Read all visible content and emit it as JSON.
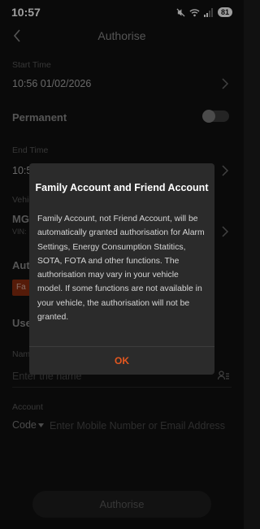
{
  "status_bar": {
    "time": "10:57",
    "battery": "81"
  },
  "header": {
    "title": "Authorise"
  },
  "start_time": {
    "label": "Start Time",
    "value": "10:56 01/02/2026"
  },
  "permanent": {
    "label": "Permanent",
    "enabled": false
  },
  "end_time": {
    "label": "End Time",
    "value_partial": "10:5"
  },
  "vehicle": {
    "label_partial": "Vehic",
    "name_partial": "MG4",
    "vin_partial": "VIN:"
  },
  "authorisation": {
    "title_partial": "Aut",
    "tag_partial": "Fa"
  },
  "user": {
    "title_partial": "Use"
  },
  "name_field": {
    "label_partial": "Nam",
    "placeholder": "Enter the name"
  },
  "account_field": {
    "label": "Account",
    "code_label": "Code",
    "placeholder": "Enter Mobile Number or Email Address"
  },
  "bottom_button": {
    "label": "Authorise"
  },
  "dialog": {
    "title": "Family Account and Friend Account",
    "body": "Family Account, not Friend Account, will be automatically granted authorisation for Alarm Settings, Energy Consumption Statitics, SOTA, FOTA and other functions. The authorisation may vary in your vehicle model. If some functions are not available in your vehicle, the authorisation will not be granted.",
    "ok_label": "OK"
  },
  "colors": {
    "accent": "#e4571f",
    "background": "#111111",
    "dialog": "#2b2b2b"
  }
}
